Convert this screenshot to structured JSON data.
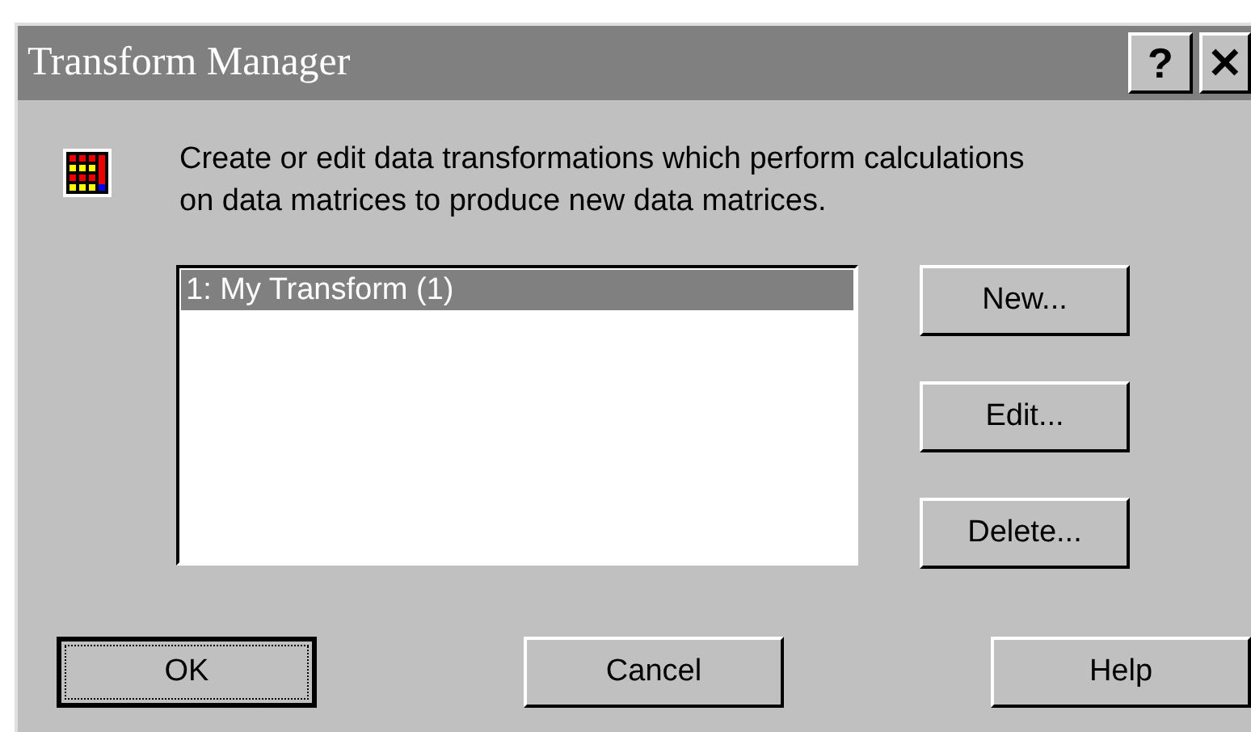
{
  "window": {
    "title": "Transform Manager",
    "title_buttons": [
      {
        "kind": "help",
        "label": "?"
      },
      {
        "kind": "close",
        "label": "✕"
      }
    ]
  },
  "description": "Create or edit data transformations which perform calculations on data matrices to produce new data matrices.",
  "transforms": [
    {
      "label": "1: My Transform (1)",
      "selected": true
    }
  ],
  "side_buttons": [
    "New...",
    "Edit...",
    "Delete..."
  ],
  "buttons": [
    {
      "label": "OK",
      "focused": true
    },
    {
      "label": "Cancel",
      "focused": false
    },
    {
      "label": "Help",
      "focused": false
    }
  ]
}
